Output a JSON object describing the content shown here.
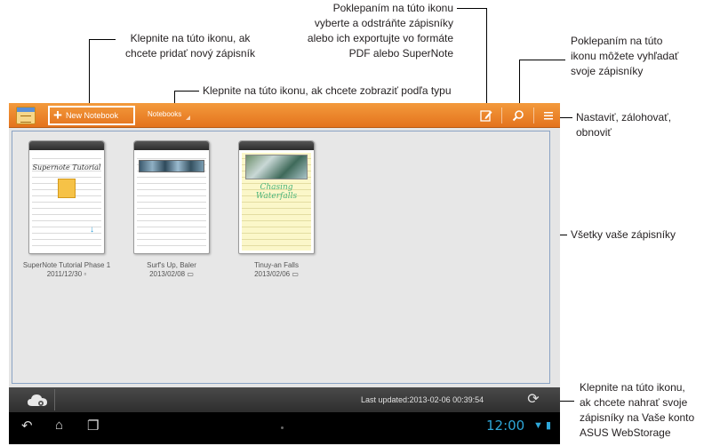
{
  "callouts": {
    "new_notebook": [
      "Klepnite na túto ikonu, ak",
      "chcete pridať nový zápisník"
    ],
    "select_delete": [
      "Poklepaním na túto ikonu",
      "vyberte a odstráňte zápisníky",
      "alebo ich exportujte vo formáte",
      "PDF alebo SuperNote"
    ],
    "search": [
      "Poklepaním na túto",
      "ikonu môžete vyhľadať",
      "svoje zápisníky"
    ],
    "by_type": "Klepnite na túto ikonu, ak chcete zobraziť podľa typu",
    "settings": [
      "Nastaviť, zálohovať,",
      "obnoviť"
    ],
    "all_notebooks": "Všetky vaše zápisníky",
    "upload": [
      "Klepnite na túto ikonu,",
      "ak chcete nahrať svoje",
      "zápisníky na Vaše konto",
      "ASUS WebStorage"
    ]
  },
  "actionbar": {
    "new_notebook_label": "New Notebook",
    "notebooks_dropdown": "Notebooks",
    "accent_color": "#ec8328"
  },
  "notebooks": [
    {
      "name": "SuperNote Tutorial Phase 1",
      "date": "2011/12/30",
      "cover_text": "Supernote Tutorial"
    },
    {
      "name": "Surf's Up, Baler",
      "date": "2013/02/08"
    },
    {
      "name": "Tinuy-an Falls",
      "date": "2013/02/06",
      "cover_text": "Chasing Waterfalls"
    }
  ],
  "bottombar": {
    "last_updated": "Last updated:2013-02-06 00:39:54"
  },
  "navbar": {
    "clock": "12:00"
  },
  "icons": {
    "app": "supernote-app-icon",
    "plus": "plus-icon",
    "edit": "edit-select-icon",
    "search": "search-icon",
    "menu": "menu-icon",
    "cloud": "cloud-upload-icon",
    "refresh": "refresh-icon",
    "back": "back-icon",
    "home": "home-icon",
    "recent": "recent-apps-icon"
  }
}
